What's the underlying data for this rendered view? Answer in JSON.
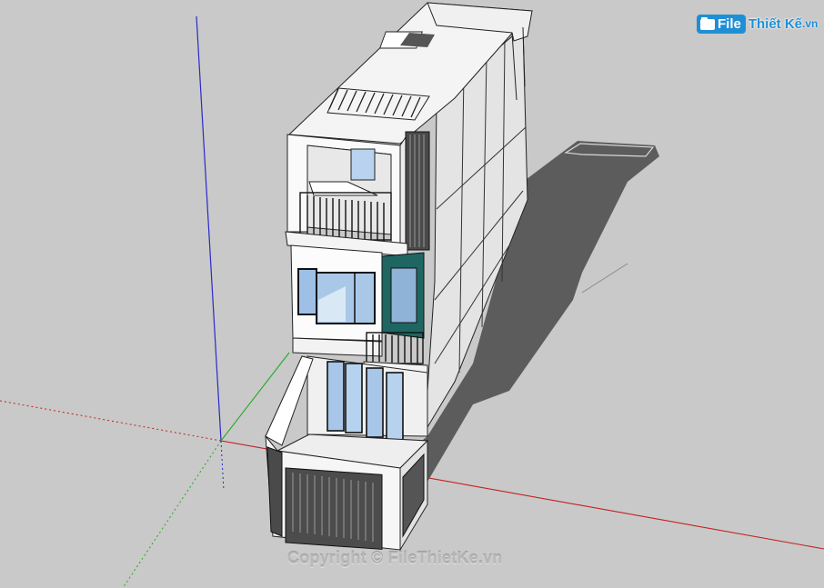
{
  "logo": {
    "file": "File",
    "rest": "Thiết Kế",
    "tld": ".vn"
  },
  "watermark": "Copyright © FileThietKe.vn",
  "scene": {
    "description_icons": [
      "building-model",
      "axis-red",
      "axis-green",
      "axis-blue",
      "shadow"
    ],
    "colors": {
      "background": "#c9c9c9",
      "red_axis": "#cc2222",
      "green_axis": "#22aa22",
      "blue_axis": "#2222cc",
      "wall": "#ffffff",
      "wall_side": "#e0e0e0",
      "shadow": "#5b5b5b",
      "glass": "#a9c8e8",
      "glass_green": "#1e6b67"
    }
  }
}
